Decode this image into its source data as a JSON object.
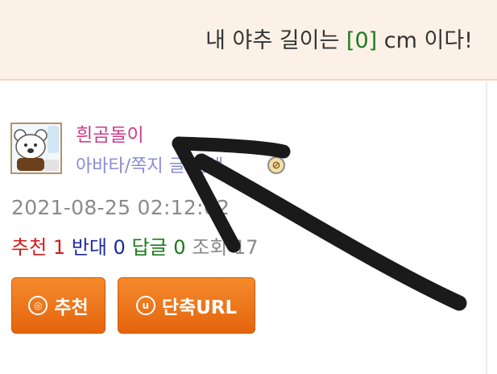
{
  "header": {
    "title_prefix": "내 야추 길이는 ",
    "title_value": "[0]",
    "title_suffix": " cm 이다!"
  },
  "author": {
    "avatar_icon": "bear-avatar-icon",
    "name": "흰곰돌이",
    "avatar_message_link": "아바타/쪽지 글 검색",
    "block_icon": "block-user-icon"
  },
  "post": {
    "date": "2021-08-25 02:12:02"
  },
  "stats": {
    "recommend_label": "추천",
    "recommend_count": "1",
    "oppose_label": "반대",
    "oppose_count": "0",
    "reply_label": "답글",
    "reply_count": "0",
    "view_label": "조회",
    "view_count": "17"
  },
  "buttons": {
    "recommend_label": "추천",
    "recommend_icon_glyph": "◎",
    "shorturl_label": "단축URL",
    "shorturl_icon_glyph": "u"
  },
  "colors": {
    "button_orange": "#ef7a1e",
    "header_bg": "#fcf1e6",
    "username": "#cc3d88",
    "link": "#8a8bd6"
  }
}
